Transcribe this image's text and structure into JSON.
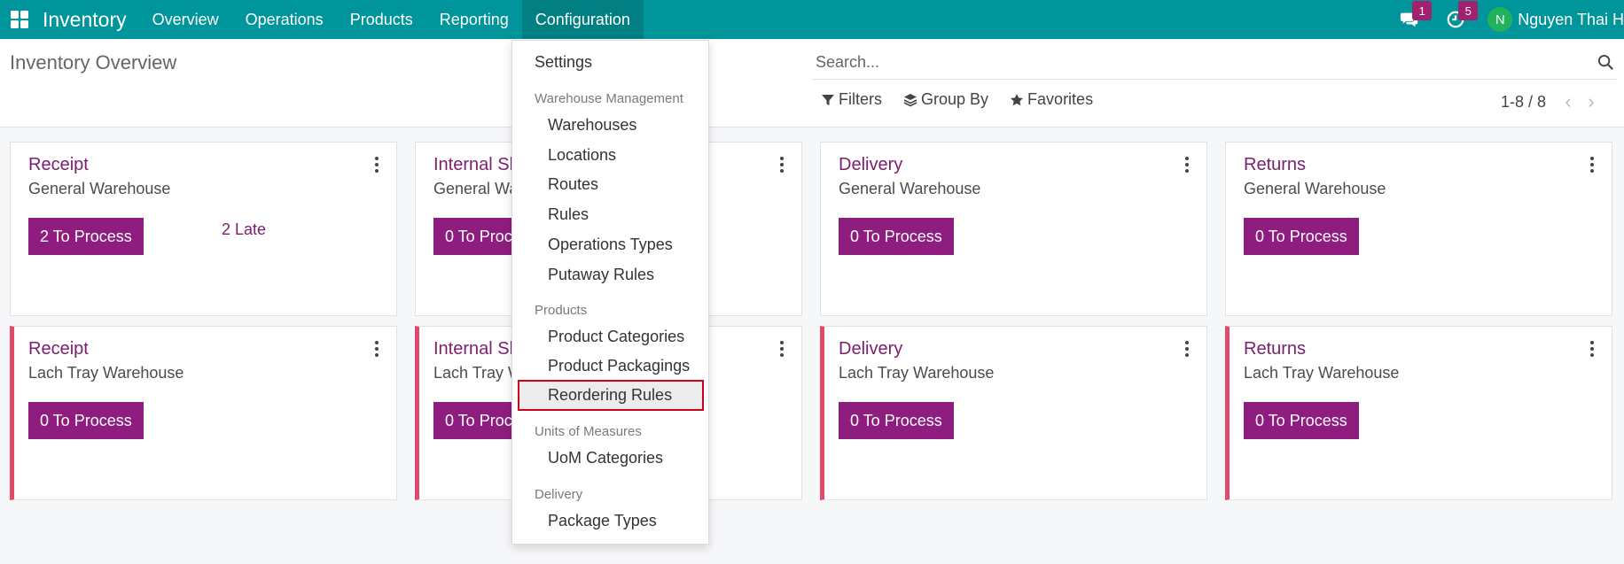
{
  "navbar": {
    "app_name": "Inventory",
    "menu": [
      "Overview",
      "Operations",
      "Products",
      "Reporting",
      "Configuration"
    ],
    "active_menu": "Configuration",
    "messages_count": "1",
    "activities_count": "5",
    "user_initial": "N",
    "user_name": "Nguyen Thai H"
  },
  "control_panel": {
    "title": "Inventory Overview",
    "search_placeholder": "Search...",
    "filters_label": "Filters",
    "group_by_label": "Group By",
    "favorites_label": "Favorites",
    "pager": "1-8 / 8"
  },
  "cards": [
    {
      "title": "Receipt",
      "warehouse": "General Warehouse",
      "process": "2 To Process",
      "late": "2 Late"
    },
    {
      "title": "Internal Sh",
      "warehouse": "General Wa",
      "process": "0 To Proce"
    },
    {
      "title": "Delivery",
      "warehouse": "General Warehouse",
      "process": "0 To Process"
    },
    {
      "title": "Returns",
      "warehouse": "General Warehouse",
      "process": "0 To Process"
    },
    {
      "title": "Receipt",
      "warehouse": "Lach Tray Warehouse",
      "process": "0 To Process"
    },
    {
      "title": "Internal Sh",
      "warehouse": "Lach Tray W",
      "process": "0 To Proce"
    },
    {
      "title": "Delivery",
      "warehouse": "Lach Tray Warehouse",
      "process": "0 To Process"
    },
    {
      "title": "Returns",
      "warehouse": "Lach Tray Warehouse",
      "process": "0 To Process"
    }
  ],
  "dropdown": {
    "settings": "Settings",
    "warehouse_header": "Warehouse Management",
    "warehouse_items": [
      "Warehouses",
      "Locations",
      "Routes",
      "Rules",
      "Operations Types",
      "Putaway Rules"
    ],
    "products_header": "Products",
    "products_items": [
      "Product Categories",
      "Product Packagings",
      "Reordering Rules"
    ],
    "uom_header": "Units of Measures",
    "uom_items": [
      "UoM Categories"
    ],
    "delivery_header": "Delivery",
    "delivery_items": [
      "Package Types"
    ]
  },
  "colors": {
    "navbar": "#00959a",
    "accent": "#8f1d80",
    "alert_border": "#e24a69",
    "highlight_box": "#d0021b"
  }
}
